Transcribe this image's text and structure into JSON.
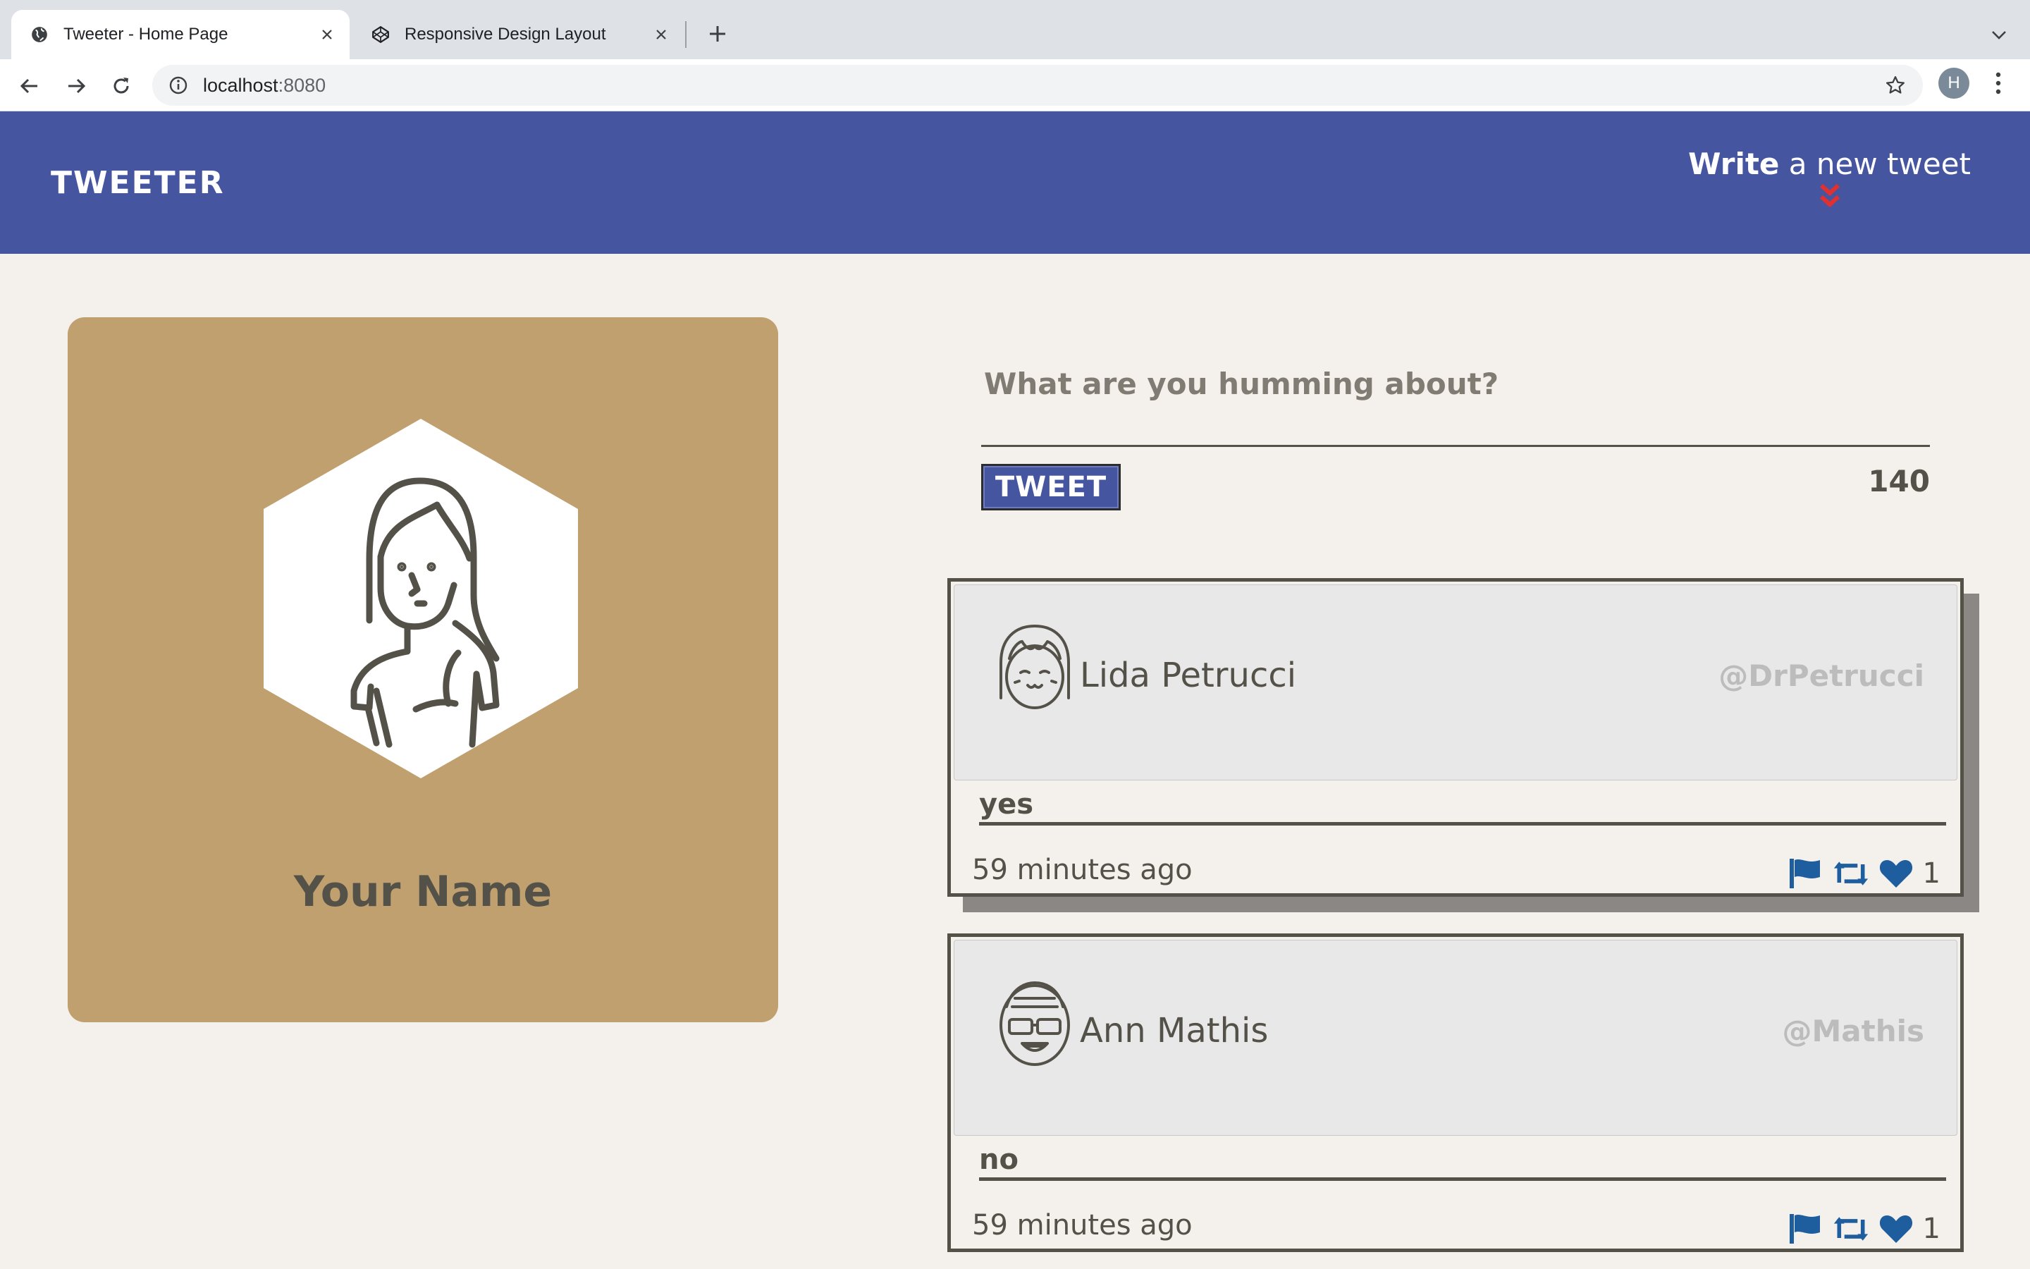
{
  "browser": {
    "tabs": [
      {
        "title": "Tweeter - Home Page",
        "active": true
      },
      {
        "title": "Responsive Design Layout",
        "active": false
      }
    ],
    "url_host": "localhost",
    "url_port": ":8080",
    "profile_initial": "H"
  },
  "header": {
    "brand": "TWEETER",
    "compose_strong": "Write",
    "compose_rest": " a new tweet"
  },
  "profile": {
    "name": "Your Name"
  },
  "compose": {
    "placeholder": "What are you humming about?",
    "button_label": "TWEET",
    "counter": "140"
  },
  "tweets": [
    {
      "name": "Lida Petrucci",
      "handle": "@DrPetrucci",
      "content": "yes",
      "time": "59 minutes ago",
      "likes": "1"
    },
    {
      "name": "Ann Mathis",
      "handle": "@Mathis",
      "content": "no",
      "time": "59 minutes ago",
      "likes": "1"
    }
  ],
  "colors": {
    "header_bg": "#4655a0",
    "page_bg": "#f4f1ec",
    "card_bg": "#bfa06e",
    "text": "#545149",
    "accent_red": "#e0302f",
    "action_blue": "#1f5e9e"
  },
  "icons": [
    "globe-icon",
    "codepen-icon",
    "close-icon",
    "plus-icon",
    "chevron-down-icon",
    "back-arrow-icon",
    "forward-arrow-icon",
    "reload-icon",
    "info-icon",
    "star-icon",
    "kebab-menu-icon",
    "double-chevron-down-icon",
    "flag-icon",
    "retweet-icon",
    "heart-icon"
  ]
}
